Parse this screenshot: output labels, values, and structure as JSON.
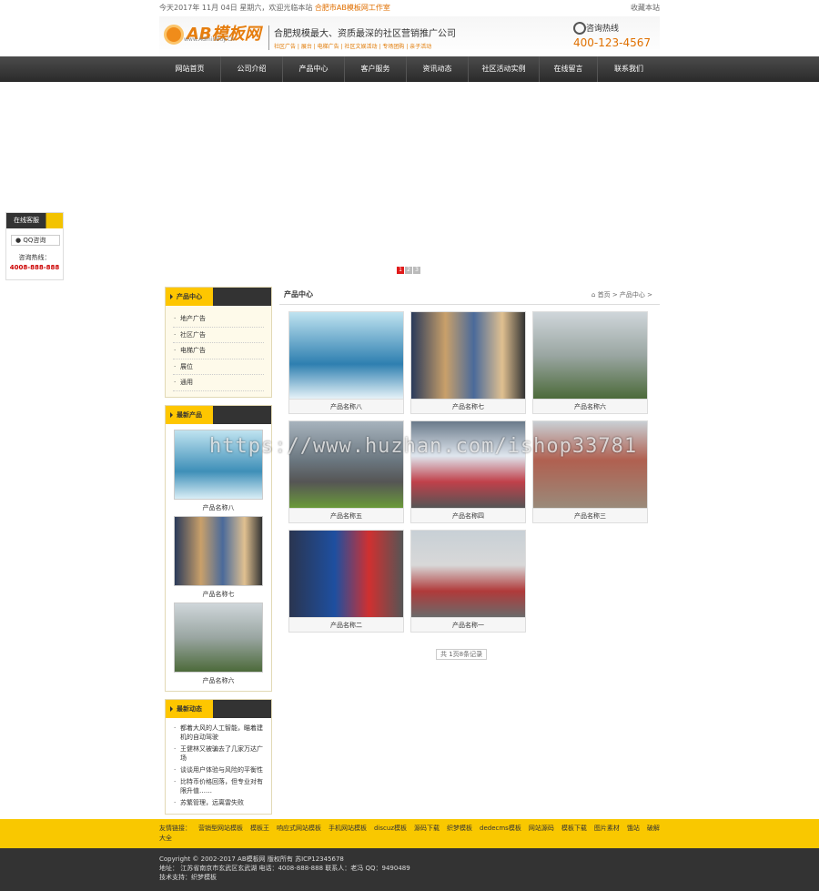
{
  "topbar": {
    "date": "今天2017年 11月 04日 星期六，欢迎光临本站",
    "company": "合肥市AB模板网工作室",
    "favorite": "收藏本站"
  },
  "header": {
    "logo": "AB模板网",
    "logo_sub": "www.AdminBuy.Cn",
    "slogan": "合肥规模最大、资质最深的社区营销推广公司",
    "slogan_sub": "社区广告 | 展台 | 电梯广告 | 社区文娱活动 | 专场团购 | 亲子活动",
    "hotline_label": "咨询热线",
    "hotline_number": "400-123-4567"
  },
  "nav": [
    "网站首页",
    "公司介绍",
    "产品中心",
    "客户服务",
    "资讯动态",
    "社区活动实例",
    "在线留言",
    "联系我们"
  ],
  "slider": {
    "pages": [
      "1",
      "2",
      "3"
    ]
  },
  "qq": {
    "title": "在线客服",
    "button": "QQ咨询",
    "hotline_label": "咨询热线：",
    "hotline": "4008-888-888"
  },
  "sidebar": {
    "cat_title": "产品中心",
    "categories": [
      "地产广告",
      "社区广告",
      "电梯广告",
      "展位",
      "通用"
    ],
    "new_title": "最新产品",
    "new_products": [
      "产品名称八",
      "产品名称七",
      "产品名称六"
    ],
    "news_title": "最新动态",
    "news": [
      "都着大风的人工智能，瞄着建机的自动驾驶",
      "王健林又被骗去了几家万达广场",
      "谈谈用户体验与风险的平衡性",
      "比特币价格回落，但专业对有限升值……",
      "苏繁管理，远离雷失败"
    ]
  },
  "content": {
    "title": "产品中心",
    "breadcrumb": "首页 > 产品中心 >",
    "products": [
      "产品名称八",
      "产品名称七",
      "产品名称六",
      "产品名称五",
      "产品名称四",
      "产品名称三",
      "产品名称二",
      "产品名称一"
    ],
    "pager": "共 1页8条记录"
  },
  "links": {
    "label": "友情链接：",
    "items": [
      "营销型网站模板",
      "模板王",
      "响应式网站模板",
      "手机网站模板",
      "discuz模板",
      "源码下载",
      "织梦模板",
      "dedecms模板",
      "网站源码",
      "模板下载",
      "图片素材",
      "饿站",
      "破解大全"
    ]
  },
  "footer": {
    "copyright": "Copyright © 2002-2017 AB模板网 版权所有   苏ICP12345678",
    "address": "地址：  江苏省南京市玄武区玄武湖   电话：4008-888-888   联系人：老冯   QQ：9490489",
    "tech": "技术支持：织梦模板"
  },
  "watermark": "https://www.huzhan.com/ishop33781",
  "colors": {
    "accent": "#f9c800",
    "nav": "#333333",
    "hotline": "#e07000"
  }
}
